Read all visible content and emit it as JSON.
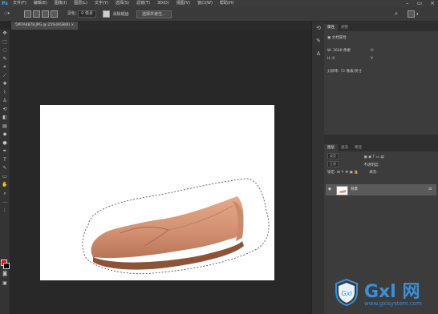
{
  "app": {
    "logo": "Ps"
  },
  "menu": {
    "items": [
      "文件(F)",
      "编辑(E)",
      "图像(I)",
      "图层(L)",
      "文字(Y)",
      "选择(S)",
      "滤镜(T)",
      "3D(D)",
      "视图(V)",
      "窗口(W)",
      "帮助(H)"
    ]
  },
  "options_bar": {
    "feather_label": "羽化:",
    "feather_value": "0 像素",
    "antialias_label": "消除锯齿",
    "select_mask_button": "选择并遮住..."
  },
  "document_tab": {
    "label": "5M7A4878.JPG @ 25%(RGB/8) ×"
  },
  "properties_panel": {
    "tabs": [
      "属性",
      "调整"
    ],
    "title": "文档属性",
    "w_label": "W:",
    "w_value": "3648 像素",
    "h_label": "H:",
    "h_value": "0",
    "x_label": "X:",
    "y_label": "Y:",
    "resolution": "分辨率: 72 像素/英寸"
  },
  "layers_panel": {
    "tabs": [
      "图层",
      "通道",
      "路径"
    ],
    "kind_label": "类型",
    "blend_mode": "正常",
    "opacity_label": "不透明度:",
    "lock_label": "锁定:",
    "fill_label": "填充:",
    "layer_name": "背景"
  },
  "watermark": {
    "brand": "Gxl 网",
    "url": "www.gxlsystem.com"
  },
  "colors": {
    "foreground": "#e60012",
    "background": "#000000",
    "accent": "#3d8fd6"
  }
}
